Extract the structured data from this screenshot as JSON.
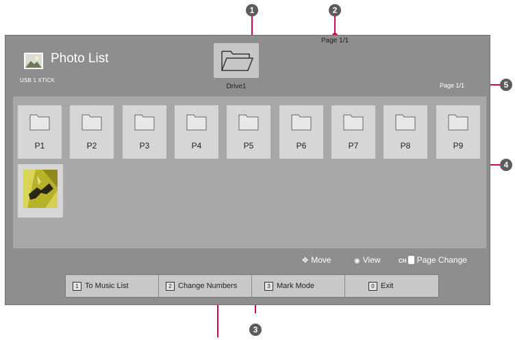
{
  "app": {
    "title": "Photo List",
    "device": "USB 1 XTICK"
  },
  "drive": {
    "label": "Drive1"
  },
  "pagination": {
    "top": "Page 1/1",
    "right": "Page 1/1"
  },
  "folders": [
    "P1",
    "P2",
    "P3",
    "P4",
    "P5",
    "P6",
    "P7",
    "P8",
    "P9"
  ],
  "hints": {
    "move": "Move",
    "view": "View",
    "ch": "CH",
    "page_change": "Page Change"
  },
  "function_bar": [
    {
      "key": "1",
      "label": "To Music List"
    },
    {
      "key": "2",
      "label": "Change Numbers"
    },
    {
      "key": "3",
      "label": "Mark Mode"
    },
    {
      "key": "0",
      "label": "Exit"
    }
  ],
  "callouts": [
    "1",
    "2",
    "3",
    "4",
    "5"
  ],
  "colors": {
    "callout": "#d0005b",
    "badge": "#5c5c5c",
    "screen": "#8e8e8e",
    "grid": "#a8a8a8",
    "tile": "#d6d6d6"
  },
  "icons": [
    "photo-app-icon",
    "open-folder-icon",
    "folder-icon",
    "move-arrows-icon",
    "view-icon",
    "channel-updown-icon"
  ]
}
